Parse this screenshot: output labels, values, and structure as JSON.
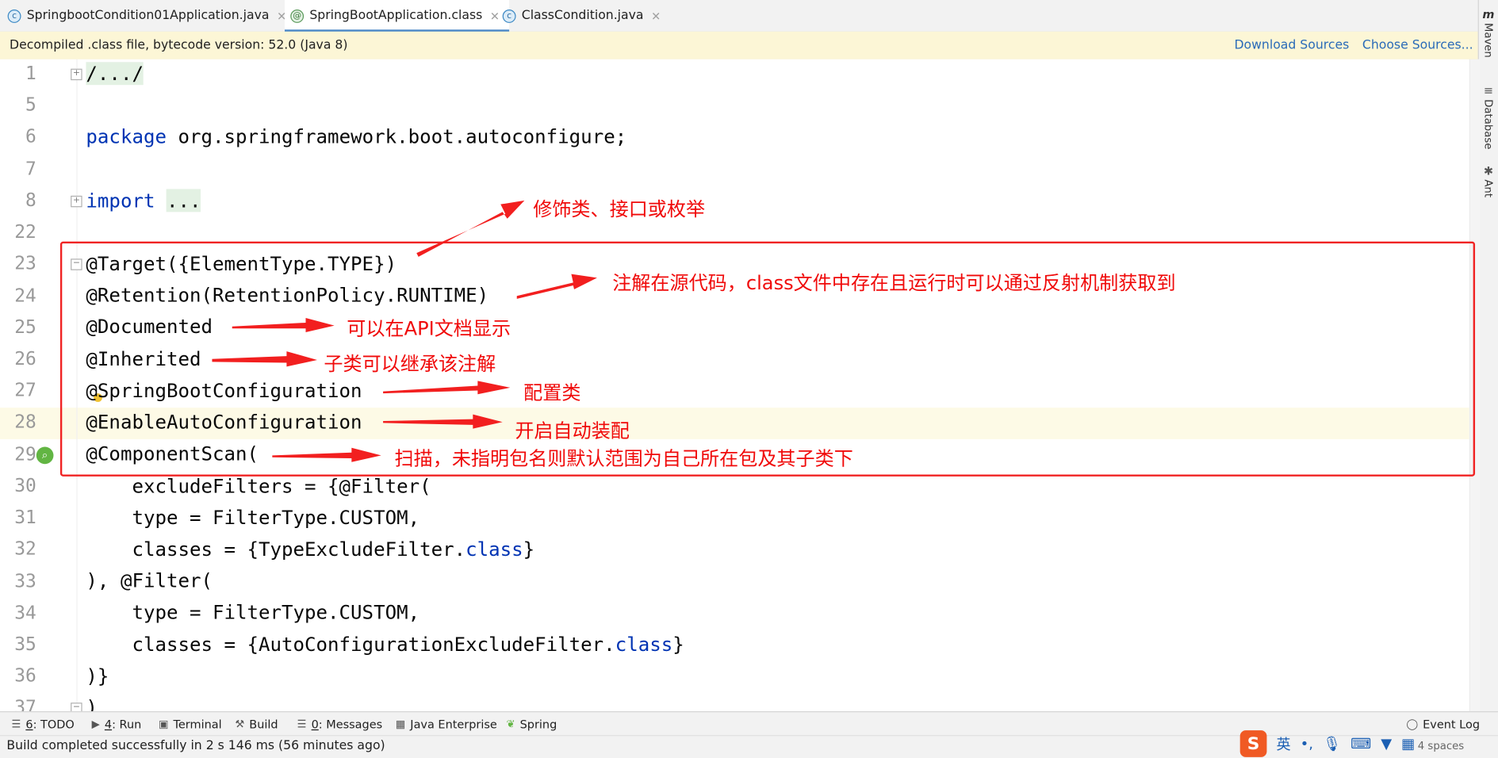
{
  "tabs": [
    {
      "label": "SpringbootCondition01Application.java",
      "icon": "class-icon",
      "active": false
    },
    {
      "label": "SpringBootApplication.class",
      "icon": "annotation-icon",
      "active": true
    },
    {
      "label": "ClassCondition.java",
      "icon": "class-icon",
      "active": false
    }
  ],
  "tab_close_glyph": "✕",
  "banner": {
    "message": "Decompiled .class file, bytecode version: 52.0 (Java 8)",
    "download_sources": "Download Sources",
    "choose_sources": "Choose Sources..."
  },
  "right_tools": {
    "maven": "Maven",
    "database": "Database",
    "ant": "Ant"
  },
  "line_numbers": [
    "1",
    "5",
    "6",
    "7",
    "8",
    "22",
    "23",
    "24",
    "25",
    "26",
    "27",
    "28",
    "29",
    "30",
    "31",
    "32",
    "33",
    "34",
    "35",
    "36",
    "37"
  ],
  "code": {
    "l1": "/.../",
    "l6_kw": "package",
    "l6_rest": " org.springframework.boot.autoconfigure;",
    "l8_kw": "import",
    "l8_rest": "...",
    "l23": "@Target({ElementType.TYPE})",
    "l24": "@Retention(RetentionPolicy.RUNTIME)",
    "l25": "@Documented",
    "l26": "@Inherited",
    "l27": "@SpringBootConfiguration",
    "l28": "@EnableAutoConfiguration",
    "l29": "@ComponentScan(",
    "l30": "    excludeFilters = {@Filter(",
    "l31": "    type = FilterType.CUSTOM,",
    "l32_a": "    classes = {TypeExcludeFilter.",
    "l32_kw": "class",
    "l32_b": "}",
    "l33": "), @Filter(",
    "l34": "    type = FilterType.CUSTOM,",
    "l35_a": "    classes = {AutoConfigurationExcludeFilter.",
    "l35_kw": "class",
    "l35_b": "}",
    "l36": ")}",
    "l37": ")"
  },
  "annotations": {
    "target": "修饰类、接口或枚举",
    "retention": "注解在源代码，class文件中存在且运行时可以通过反射机制获取到",
    "documented": "可以在API文档显示",
    "inherited": "子类可以继承该注解",
    "config": "配置类",
    "auto": "开启自动装配",
    "scan": "扫描，未指明包名则默认范围为自己所在包及其子类下"
  },
  "tool_windows": [
    {
      "key": "6",
      "label": ": TODO",
      "icon": "list-icon"
    },
    {
      "key": "4",
      "label": ": Run",
      "icon": "run-icon"
    },
    {
      "key": "",
      "label": "Terminal",
      "icon": "terminal-icon"
    },
    {
      "key": "",
      "label": "Build",
      "icon": "hammer-icon"
    },
    {
      "key": "0",
      "label": ": Messages",
      "icon": "messages-icon"
    },
    {
      "key": "",
      "label": "Java Enterprise",
      "icon": "javaee-icon"
    },
    {
      "key": "",
      "label": "Spring",
      "icon": "spring-icon"
    }
  ],
  "event_log": "Event Log",
  "status_text": "Build completed successfully in 2 s 146 ms (56 minutes ago)",
  "indent_text": "4 spaces",
  "ime": {
    "lang": "英",
    "punct": "•,"
  },
  "colors": {
    "keyword": "#0033b3",
    "annotation_red": "#f02323",
    "link": "#2a6bb8",
    "banner_bg": "#fcf6d6"
  }
}
